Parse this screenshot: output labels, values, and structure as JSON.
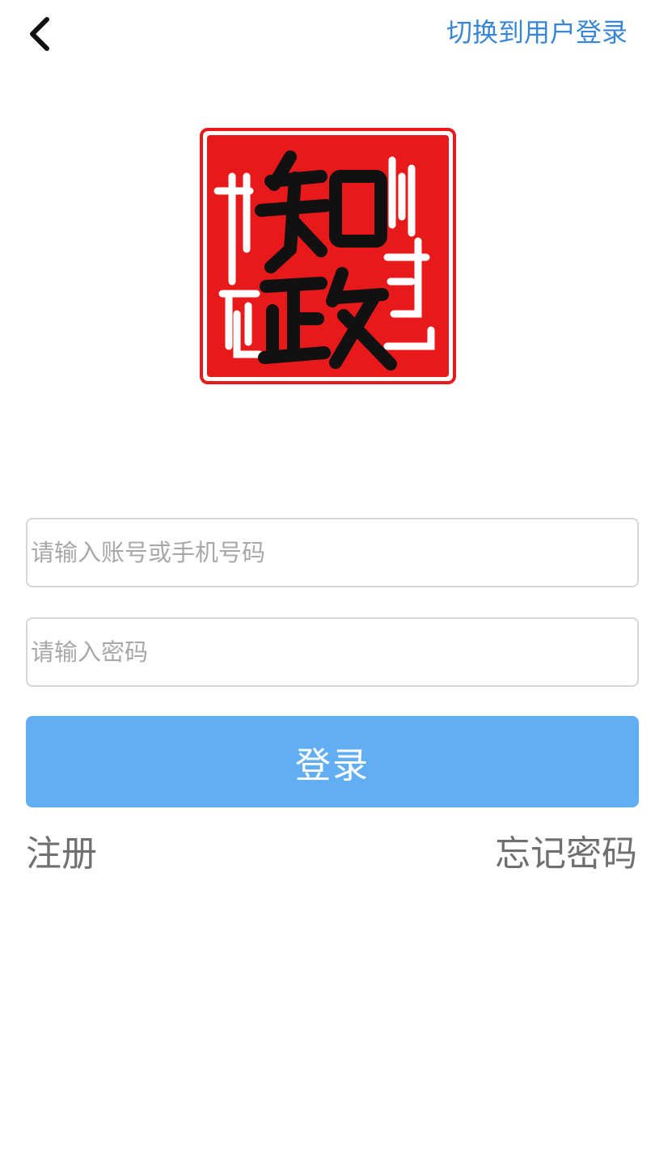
{
  "header": {
    "back_icon": "chevron-left-icon",
    "switch_label": "切换到用户登录"
  },
  "logo": {
    "icon": "seal-logo",
    "colors": {
      "seal_red": "#e8191a",
      "border_red": "#e8191a",
      "glyph_black": "#111111",
      "glyph_white": "#ffffff"
    }
  },
  "form": {
    "account_placeholder": "请输入账号或手机号码",
    "account_value": "",
    "password_placeholder": "请输入密码",
    "password_value": "",
    "login_label": "登录"
  },
  "links": {
    "register_label": "注册",
    "forgot_label": "忘记密码"
  },
  "theme": {
    "accent": "#62aef3",
    "link_blue": "#3a86d6",
    "muted_text": "#707070",
    "border": "#d6d6d6"
  }
}
